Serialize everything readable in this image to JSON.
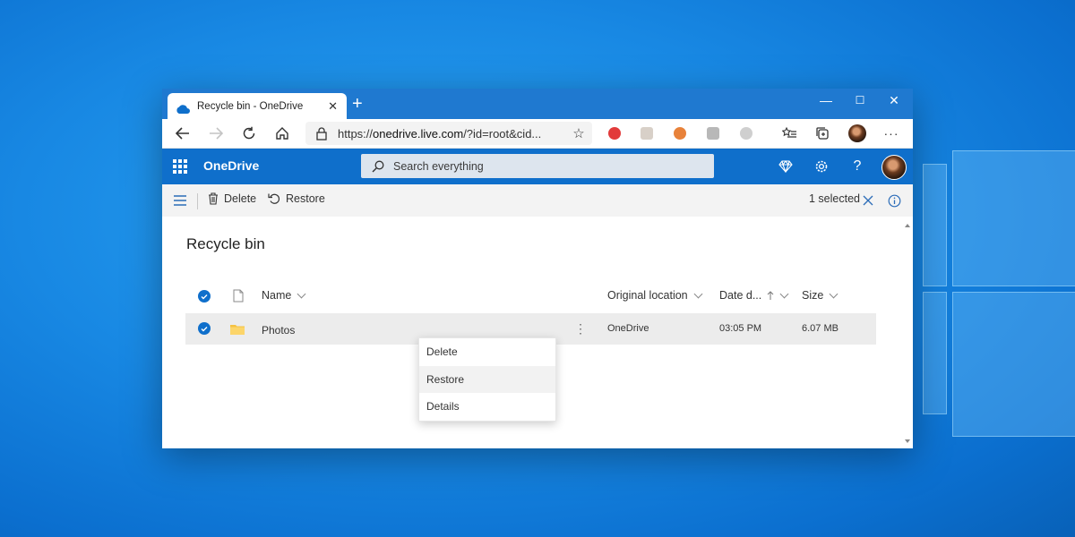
{
  "colors": {
    "titlebar": "#1f79d0",
    "onedrive_bar": "#0f6fcb",
    "accent": "#0f6fcb",
    "folder": "#f5c242"
  },
  "tab": {
    "title": "Recycle bin - OneDrive",
    "close": "✕",
    "new_tab": "+"
  },
  "window_controls": {
    "minimize": "—",
    "maximize": "☐",
    "close": "✕"
  },
  "address_bar": {
    "prefix": "https://",
    "host": "onedrive.live.com",
    "path": "/?id=root&cid..."
  },
  "onedrive_bar": {
    "brand": "OneDrive",
    "search_placeholder": "Search everything",
    "help": "?"
  },
  "command_bar": {
    "delete": "Delete",
    "restore": "Restore",
    "selected": "1 selected"
  },
  "page": {
    "title": "Recycle bin"
  },
  "table": {
    "columns": {
      "name": "Name",
      "original_location": "Original location",
      "date_deleted": "Date d...",
      "size": "Size"
    },
    "rows": [
      {
        "name": "Photos",
        "original_location": "OneDrive",
        "date_deleted": "03:05 PM",
        "size": "6.07 MB"
      }
    ]
  },
  "context_menu": {
    "items": [
      "Delete",
      "Restore",
      "Details"
    ]
  }
}
